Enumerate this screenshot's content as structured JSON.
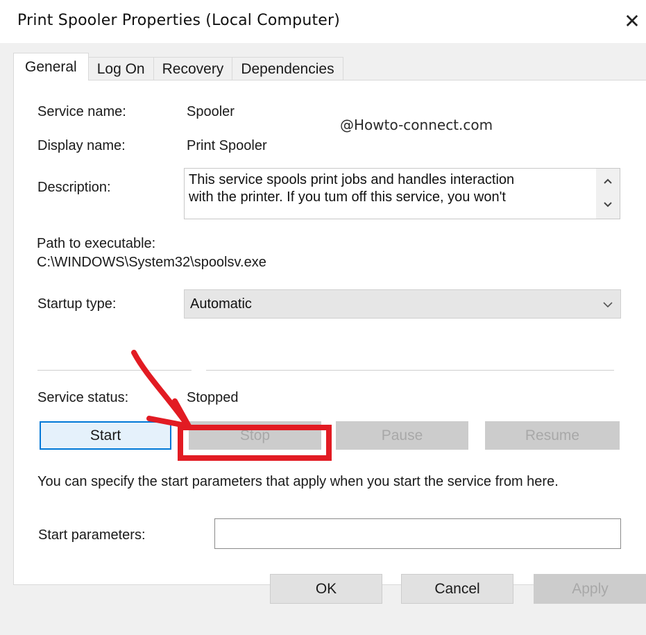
{
  "window": {
    "title": "Print Spooler Properties (Local Computer)",
    "close_glyph": "✕"
  },
  "tabs": [
    {
      "label": "General",
      "active": true
    },
    {
      "label": "Log On",
      "active": false
    },
    {
      "label": "Recovery",
      "active": false
    },
    {
      "label": "Dependencies",
      "active": false
    }
  ],
  "watermark": "@Howto-connect.com",
  "general": {
    "service_name_label": "Service name:",
    "service_name_value": "Spooler",
    "display_name_label": "Display name:",
    "display_name_value": "Print Spooler",
    "description_label": "Description:",
    "description_line1": "This service spools print jobs and handles interaction",
    "description_line2": "with the printer.  If you tum off this service, you won't",
    "path_label": "Path to executable:",
    "path_value": "C:\\WINDOWS\\System32\\spoolsv.exe",
    "startup_type_label": "Startup type:",
    "startup_type_value": "Automatic",
    "service_status_label": "Service status:",
    "service_status_value": "Stopped"
  },
  "control_buttons": {
    "start": "Start",
    "stop": "Stop",
    "pause": "Pause",
    "resume": "Resume"
  },
  "hint_text": "You can specify the start parameters that apply when you start the service from here.",
  "start_parameters": {
    "label": "Start parameters:",
    "value": ""
  },
  "footer": {
    "ok": "OK",
    "cancel": "Cancel",
    "apply": "Apply"
  },
  "annotation": {
    "color": "#e21b23"
  }
}
